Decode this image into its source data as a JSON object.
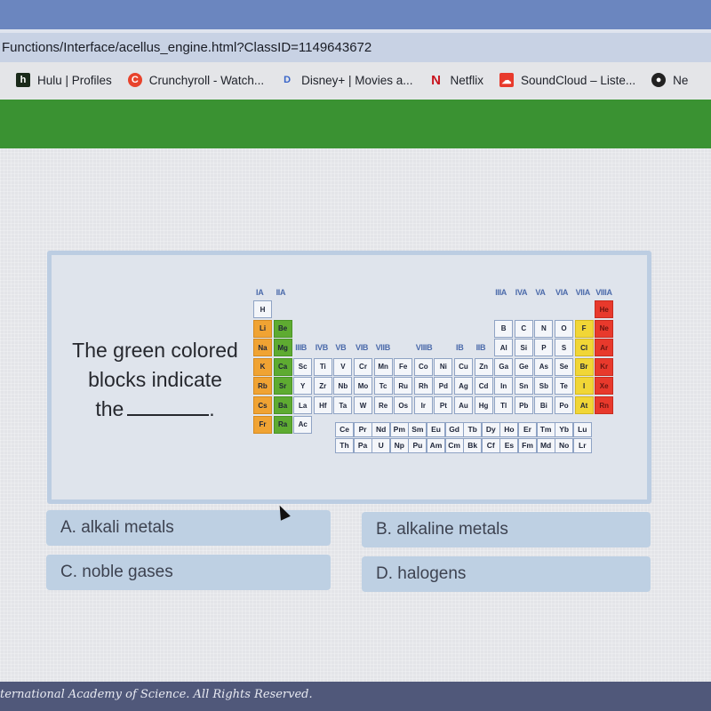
{
  "browser": {
    "url": "Functions/Interface/acellus_engine.html?ClassID=1149643672",
    "bookmarks": [
      {
        "label": "Hulu | Profiles",
        "icon": "hulu-icon",
        "glyph": "h",
        "color": "#1a2a1a"
      },
      {
        "label": "Crunchyroll - Watch...",
        "icon": "crunchyroll-icon",
        "glyph": "C",
        "color": "#e8432c"
      },
      {
        "label": "Disney+ | Movies a...",
        "icon": "disney-icon",
        "glyph": "D",
        "color": "#3864c8"
      },
      {
        "label": "Netflix",
        "icon": "netflix-icon",
        "glyph": "N",
        "color": "#c8141e"
      },
      {
        "label": "SoundCloud – Liste...",
        "icon": "soundcloud-icon",
        "glyph": "☁",
        "color": "#e83a2c"
      },
      {
        "label": "Ne",
        "icon": "globe-icon",
        "glyph": "●",
        "color": "#222"
      }
    ]
  },
  "question": {
    "line1": "The green colored",
    "line2": "blocks indicate",
    "line3": "the",
    "end": "."
  },
  "periodic_table": {
    "group_labels_left": [
      "IA",
      "IIA"
    ],
    "group_labels_transition": [
      "IIIB",
      "IVB",
      "VB",
      "VIB",
      "VIIB",
      "VIIIB",
      "IB",
      "IIB"
    ],
    "group_labels_right": [
      "IIIA",
      "IVA",
      "VA",
      "VIA",
      "VIIA",
      "VIIIA"
    ],
    "legend_colors": {
      "alkali": "#f0a333",
      "alkaline_earth": "#5eab31",
      "halogen": "#f1d636",
      "noble": "#e8392c"
    },
    "rows": [
      [
        "H",
        null,
        null,
        null,
        null,
        null,
        null,
        null,
        null,
        null,
        null,
        null,
        null,
        null,
        null,
        null,
        null,
        "He"
      ],
      [
        "Li",
        "Be",
        null,
        null,
        null,
        null,
        null,
        null,
        null,
        null,
        null,
        null,
        "B",
        "C",
        "N",
        "O",
        "F",
        "Ne"
      ],
      [
        "Na",
        "Mg",
        null,
        null,
        null,
        null,
        null,
        null,
        null,
        null,
        null,
        null,
        "Al",
        "Si",
        "P",
        "S",
        "Cl",
        "Ar"
      ],
      [
        "K",
        "Ca",
        "Sc",
        "Ti",
        "V",
        "Cr",
        "Mn",
        "Fe",
        "Co",
        "Ni",
        "Cu",
        "Zn",
        "Ga",
        "Ge",
        "As",
        "Se",
        "Br",
        "Kr"
      ],
      [
        "Rb",
        "Sr",
        "Y",
        "Zr",
        "Nb",
        "Mo",
        "Tc",
        "Ru",
        "Rh",
        "Pd",
        "Ag",
        "Cd",
        "In",
        "Sn",
        "Sb",
        "Te",
        "I",
        "Xe"
      ],
      [
        "Cs",
        "Ba",
        "La",
        "Hf",
        "Ta",
        "W",
        "Re",
        "Os",
        "Ir",
        "Pt",
        "Au",
        "Hg",
        "Tl",
        "Pb",
        "Bi",
        "Po",
        "At",
        "Rn"
      ],
      [
        "Fr",
        "Ra",
        "Ac",
        null,
        null,
        null,
        null,
        null,
        null,
        null,
        null,
        null,
        null,
        null,
        null,
        null,
        null,
        null
      ]
    ],
    "lanthanides": [
      "Ce",
      "Pr",
      "Nd",
      "Pm",
      "Sm",
      "Eu",
      "Gd",
      "Tb",
      "Dy",
      "Ho",
      "Er",
      "Tm",
      "Yb",
      "Lu"
    ],
    "actinides": [
      "Th",
      "Pa",
      "U",
      "Np",
      "Pu",
      "Am",
      "Cm",
      "Bk",
      "Cf",
      "Es",
      "Fm",
      "Md",
      "No",
      "Lr"
    ]
  },
  "answers": [
    {
      "letter": "A.",
      "text": "alkali metals"
    },
    {
      "letter": "B.",
      "text": "alkaline metals"
    },
    {
      "letter": "C.",
      "text": "noble gases"
    },
    {
      "letter": "D.",
      "text": "halogens"
    }
  ],
  "footer": {
    "text": "ternational Academy of Science.  All Rights Reserved."
  }
}
